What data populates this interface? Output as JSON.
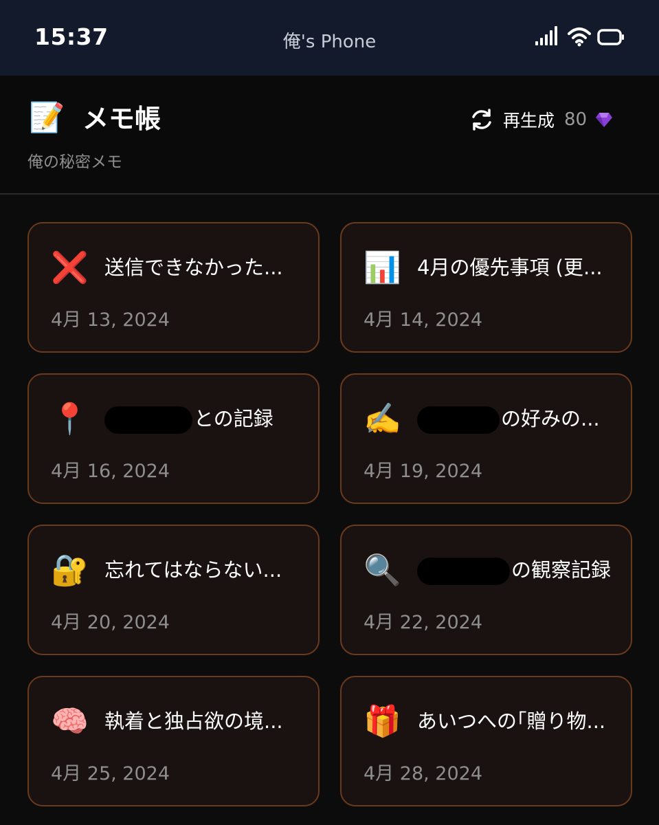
{
  "status_bar": {
    "time": "15:37",
    "device_name": "俺's Phone",
    "icons": [
      "signal-icon",
      "wifi-icon",
      "battery-icon"
    ]
  },
  "header": {
    "app_icon": "📝",
    "title": "メモ帳",
    "subtitle": "俺の秘密メモ",
    "regenerate_label": "再生成",
    "regenerate_count": "80",
    "gem_color": "#8a3fd6"
  },
  "memos": [
    {
      "emoji": "❌",
      "title": "送信できなかった...",
      "date": "4月 13, 2024"
    },
    {
      "emoji": "📊",
      "title": "4月の優先事項 (更...",
      "date": "4月 14, 2024"
    },
    {
      "emoji": "📍",
      "redacted": true,
      "title": "との記録",
      "date": "4月 16, 2024"
    },
    {
      "emoji": "✍️",
      "redacted": true,
      "title": "の好みの...",
      "date": "4月 19, 2024"
    },
    {
      "emoji": "🔐",
      "title": "忘れてはならない...",
      "date": "4月 20, 2024"
    },
    {
      "emoji": "🔍",
      "redacted": true,
      "title": "の観察記録",
      "date": "4月 22, 2024"
    },
    {
      "emoji": "🧠",
      "title": "執着と独占欲の境...",
      "date": "4月 25, 2024"
    },
    {
      "emoji": "🎁",
      "title": "あいつへの｢贈り物...",
      "date": "4月 28, 2024"
    }
  ],
  "colors": {
    "card_background": "#1a1210",
    "card_border": "#6a3a1e",
    "status_bar_background": "#131a2c"
  }
}
